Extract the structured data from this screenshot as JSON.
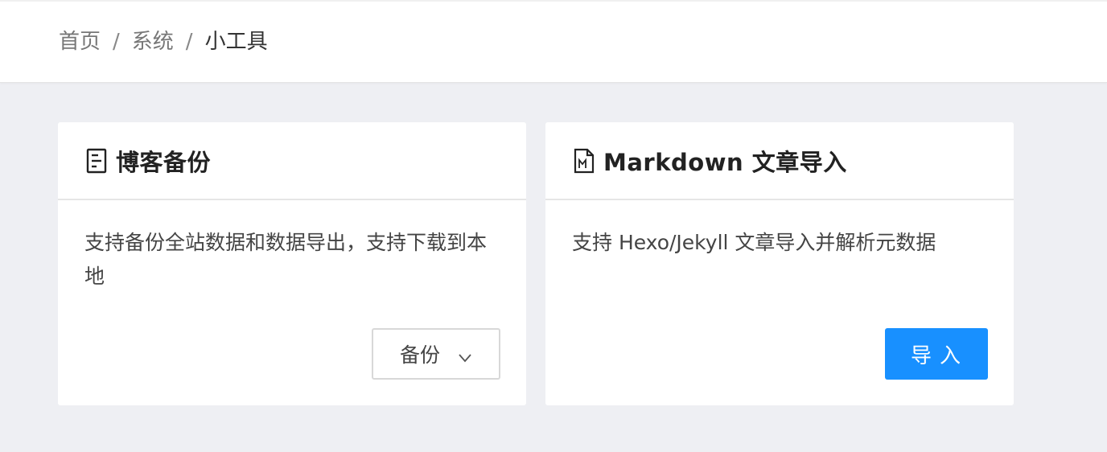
{
  "breadcrumb": {
    "items": [
      "首页",
      "系统",
      "小工具"
    ],
    "separator": "/"
  },
  "cards": [
    {
      "icon": "document-lines-icon",
      "title": "博客备份",
      "description": "支持备份全站数据和数据导出，支持下载到本地",
      "button_label": "备份",
      "button_icon": "chevron-down-icon"
    },
    {
      "icon": "markdown-file-icon",
      "title": "Markdown 文章导入",
      "description": "支持 Hexo/Jekyll 文章导入并解析元数据",
      "button_label": "导入"
    }
  ],
  "colors": {
    "primary": "#1890ff",
    "page_background": "#eeeff3"
  }
}
